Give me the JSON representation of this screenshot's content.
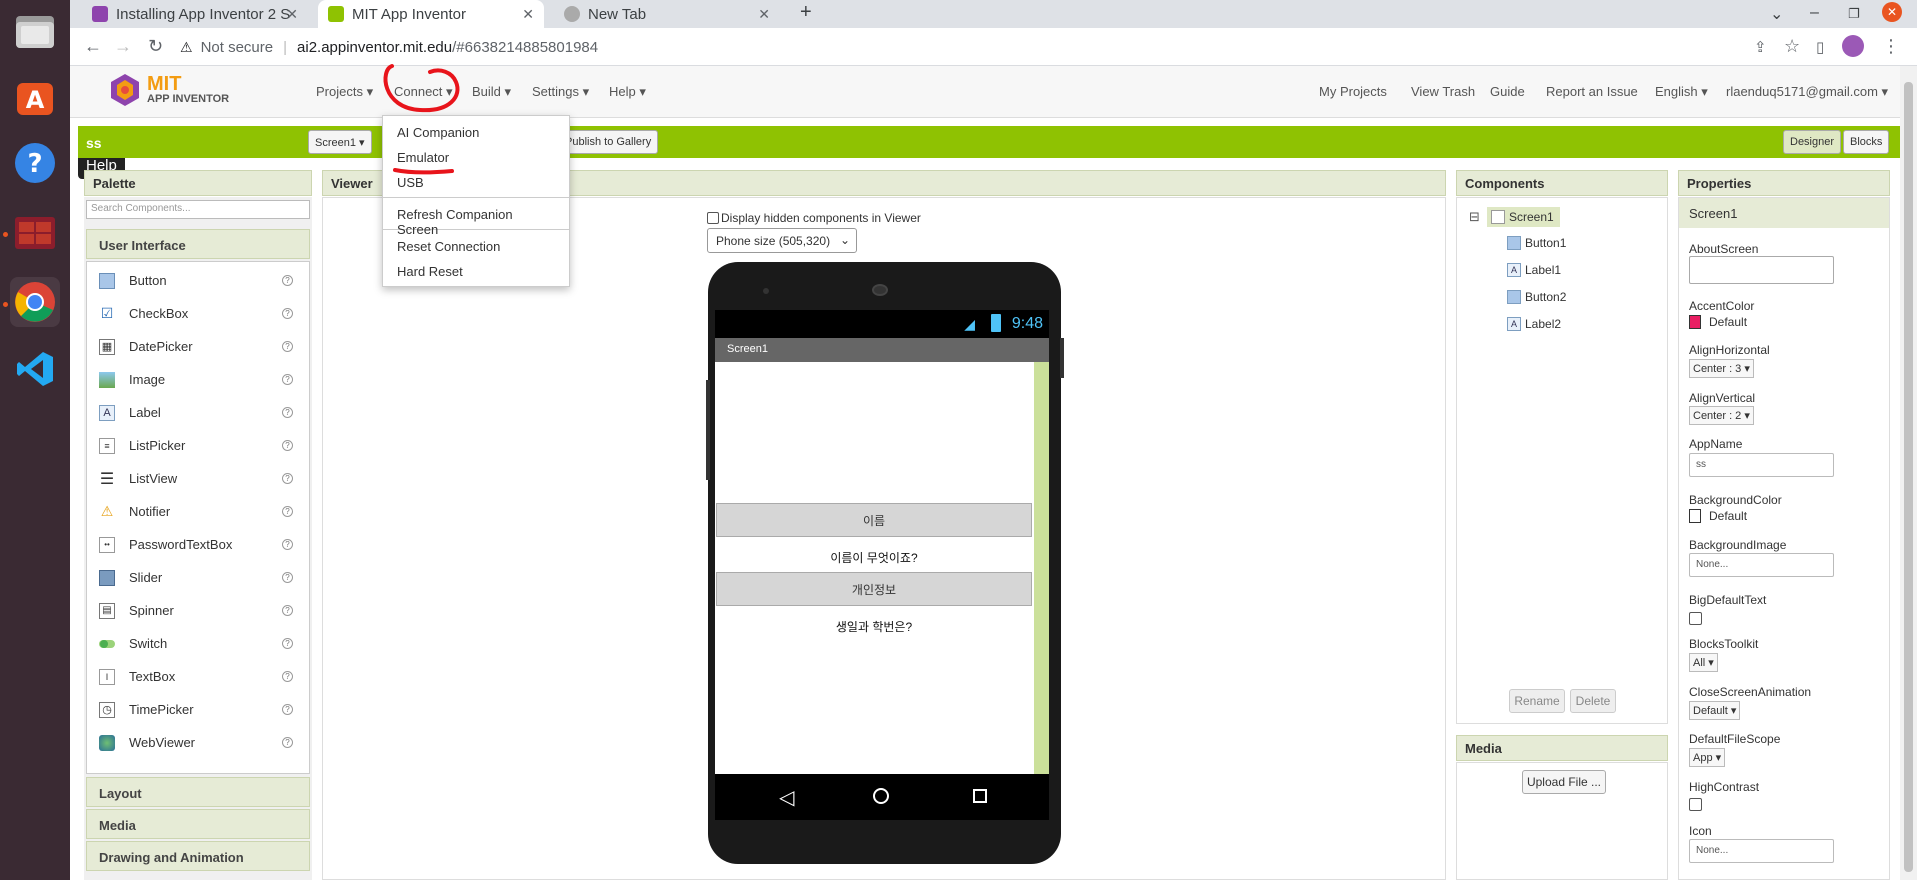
{
  "dock": {
    "help_tooltip": "Help"
  },
  "browser": {
    "tabs": [
      {
        "title": "Installing App Inventor 2 S"
      },
      {
        "title": "MIT App Inventor"
      },
      {
        "title": "New Tab"
      }
    ],
    "security_label": "Not secure",
    "url_host": "ai2.appinventor.mit.edu",
    "url_rest": "/#6638214885801984"
  },
  "app": {
    "logo_top": "MIT",
    "logo_sub": "APP INVENTOR",
    "menus": [
      "Projects ▾",
      "Connect ▾",
      "Build ▾",
      "Settings ▾",
      "Help ▾"
    ],
    "right_links": [
      "My Projects",
      "View Trash",
      "Guide",
      "Report an Issue",
      "English ▾",
      "rlaenduq5171@gmail.com ▾"
    ],
    "connect_menu": [
      "AI Companion",
      "Emulator",
      "USB",
      "Refresh Companion Screen",
      "Reset Connection",
      "Hard Reset"
    ]
  },
  "toolbar": {
    "project": "ss",
    "screen_select": "Screen1 ▾",
    "publish": "Publish to Gallery",
    "designer": "Designer",
    "blocks": "Blocks"
  },
  "palette": {
    "title": "Palette",
    "search_placeholder": "Search Components...",
    "section": "User Interface",
    "items": [
      "Button",
      "CheckBox",
      "DatePicker",
      "Image",
      "Label",
      "ListPicker",
      "ListView",
      "Notifier",
      "PasswordTextBox",
      "Slider",
      "Spinner",
      "Switch",
      "TextBox",
      "TimePicker",
      "WebViewer"
    ],
    "more_sections": [
      "Layout",
      "Media",
      "Drawing and Animation"
    ]
  },
  "viewer": {
    "title": "Viewer",
    "hidden_label": "Display hidden components in Viewer",
    "size_select": "Phone size (505,320)",
    "time": "9:48",
    "screen_title": "Screen1",
    "button1": "이름",
    "label1": "이름이 무엇이죠?",
    "button2": "개인정보",
    "label2": "생일과 학번은?"
  },
  "components": {
    "title": "Components",
    "tree": [
      "Screen1",
      "Button1",
      "Label1",
      "Button2",
      "Label2"
    ],
    "rename": "Rename",
    "delete": "Delete",
    "collapse": "⊟"
  },
  "media": {
    "title": "Media",
    "upload": "Upload File ..."
  },
  "properties": {
    "title": "Properties",
    "subject": "Screen1",
    "about_screen": "AboutScreen",
    "accent_color": "AccentColor",
    "accent_value": "Default",
    "align_h": "AlignHorizontal",
    "align_h_value": "Center : 3 ▾",
    "align_v": "AlignVertical",
    "align_v_value": "Center : 2 ▾",
    "app_name": "AppName",
    "app_name_value": "ss",
    "bg_color": "BackgroundColor",
    "bg_color_value": "Default",
    "bg_image": "BackgroundImage",
    "bg_image_value": "None...",
    "big_text": "BigDefaultText",
    "blocks_toolkit": "BlocksToolkit",
    "blocks_toolkit_value": "All ▾",
    "close_anim": "CloseScreenAnimation",
    "close_anim_value": "Default ▾",
    "file_scope": "DefaultFileScope",
    "file_scope_value": "App ▾",
    "high_contrast": "HighContrast",
    "icon": "Icon",
    "icon_value": "None..."
  },
  "colors": {
    "green": "#8fc202",
    "accent": "#e91e63",
    "annotation": "#e8141b"
  }
}
